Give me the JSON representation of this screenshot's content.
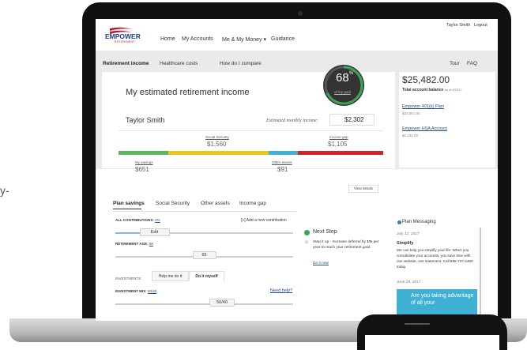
{
  "edge_text": "y-",
  "brand": {
    "logo_text": "EMPOWER",
    "logo_sub": "RETIREMENT",
    "primary": "#1a3f8f",
    "accent": "#c8102e"
  },
  "nav": {
    "items": [
      "Home",
      "My Accounts",
      "Me & My Money ▾",
      "Guidance"
    ]
  },
  "user": {
    "name": "Taylor Smith",
    "logout": "Logout"
  },
  "tabs": [
    "Retirement income",
    "Healthcare costs",
    "How do I compare"
  ],
  "help_links": [
    "Tour",
    "FAQ"
  ],
  "income_card": {
    "title": "My estimated retirement income",
    "person": "Taylor Smith",
    "estimated_label": "Estimated monthly income:",
    "estimated_value": "$2,302",
    "social_security_label": "Social Security",
    "social_security_value": "$1,560",
    "income_gap_label": "Income gap",
    "income_gap_value": "$1,105",
    "my_savings_label": "My savings",
    "my_savings_value": "$651",
    "other_assets_label": "Other assets",
    "other_assets_value": "$91",
    "bar_colors": {
      "savings": "#5cb85c",
      "social_security": "#f0c419",
      "other_assets": "#3fb1d4",
      "gap": "#d0232a"
    }
  },
  "gauge": {
    "percent_number": "68",
    "percent_sign": "%",
    "goal_link": "of my goal",
    "fraction": 0.68,
    "color": "#3aa655"
  },
  "balance": {
    "amount": "$25,482.00",
    "caption": "Total account balance",
    "as_of": "as of 6/2017",
    "accounts": [
      {
        "name": "Empower 401(k) Plan",
        "value": "$23,051.00"
      },
      {
        "name": "Empower HSA Account",
        "value": "$2,431.00"
      }
    ]
  },
  "view_details": "View details",
  "plan_tabs": [
    "Plan savings",
    "Social Security",
    "Other assets",
    "Income gap"
  ],
  "contributions": {
    "label": "ALL CONTRIBUTIONS:",
    "value": "6%",
    "add": "[+] Add a new contribution",
    "handle": "Edit",
    "fraction": 0.22
  },
  "retirement_age": {
    "label": "RETIREMENT AGE:",
    "value": "65",
    "handle": "65",
    "fraction": 0.5
  },
  "investments": {
    "label": "INVESTMENTS:",
    "tabs": [
      "Help me do it",
      "Do it myself"
    ]
  },
  "investment_mix": {
    "label": "INVESTMENT MIX:",
    "value": "60/40",
    "handle": "50/40",
    "help": "Need help?",
    "fraction": 0.6
  },
  "next_step": {
    "title": "Next Step",
    "text_prefix": "Step it up - Increase deferral by",
    "text_bold": "1%",
    "text_suffix": "per year to reach your retirement goal.",
    "link": "Do it now"
  },
  "plan_messaging": {
    "title": "Plan Messaging",
    "date1": "July 12, 2017",
    "heading": "Simplify",
    "body": "We can help you simplify your life. When you consolidate your accounts, you save time with one website, one statement. Call 888-737-4480 today.",
    "date2": "June 28, 2017",
    "promo": "Are you taking advantage of all your"
  }
}
